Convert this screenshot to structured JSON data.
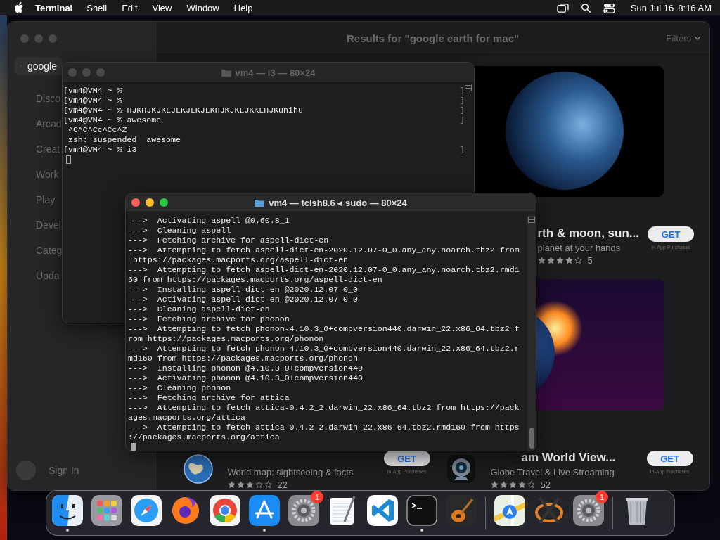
{
  "menu_bar": {
    "app_name": "Terminal",
    "menus": [
      "Shell",
      "Edit",
      "View",
      "Window",
      "Help"
    ],
    "date": "Sun Jul 16",
    "time": "8:16 AM"
  },
  "app_store": {
    "active": false,
    "search": {
      "value": "google"
    },
    "sidebar_items": [
      "Disco",
      "Arcad",
      "Creat",
      "Work",
      "Play",
      "Devel",
      "Categ",
      "Upda"
    ],
    "sign_in": "Sign In",
    "results_title": "Results for \"google earth for mac\"",
    "filters": "Filters",
    "featured": {
      "title": "rth & moon, sun...",
      "subtitle": "planet at your hands",
      "stars": 4,
      "rating_count": "5",
      "button": "GET",
      "note": "In-App Purchases"
    },
    "results": [
      {
        "kind": "globe",
        "subtitle": "World map: sightseeing & facts",
        "stars": 3,
        "rating_count": "22",
        "button": "GET",
        "note": "In-App Purchases"
      },
      {
        "kind": "webcam",
        "title": "am World View...",
        "subtitle": "Globe Travel & Live Streaming",
        "stars": 4,
        "rating_count": "52",
        "button": "GET",
        "note": "In-App Purchases"
      }
    ]
  },
  "back_terminal": {
    "title": "vm4 — i3 — 80×24",
    "active": false,
    "lines": [
      {
        "text": "[vm4@VM4 ~ %",
        "mark": "]"
      },
      {
        "text": "[vm4@VM4 ~ %",
        "mark": "]"
      },
      {
        "text": "[vm4@VM4 ~ % HJKHJKJKLJLKJLKJLKHJKJKLJKKLHJKunihu",
        "mark": "]"
      },
      {
        "text": "[vm4@VM4 ~ % awesome",
        "mark": "]"
      },
      {
        "text": " ^C^C^Cc^Cc^Z"
      },
      {
        "text": " zsh: suspended  awesome"
      },
      {
        "text": "[vm4@VM4 ~ % i3",
        "mark": "]"
      }
    ]
  },
  "front_terminal": {
    "title": "vm4 — tclsh8.6 ◂ sudo — 80×24",
    "active": true,
    "lines": [
      "--->  Activating aspell @0.60.8_1",
      "--->  Cleaning aspell",
      "--->  Fetching archive for aspell-dict-en",
      "--->  Attempting to fetch aspell-dict-en-2020.12.07-0_0.any_any.noarch.tbz2 from",
      " https://packages.macports.org/aspell-dict-en",
      "--->  Attempting to fetch aspell-dict-en-2020.12.07-0_0.any_any.noarch.tbz2.rmd1",
      "60 from https://packages.macports.org/aspell-dict-en",
      "--->  Installing aspell-dict-en @2020.12.07-0_0",
      "--->  Activating aspell-dict-en @2020.12.07-0_0",
      "--->  Cleaning aspell-dict-en",
      "--->  Fetching archive for phonon",
      "--->  Attempting to fetch phonon-4.10.3_0+compversion440.darwin_22.x86_64.tbz2 f",
      "rom https://packages.macports.org/phonon",
      "--->  Attempting to fetch phonon-4.10.3_0+compversion440.darwin_22.x86_64.tbz2.r",
      "md160 from https://packages.macports.org/phonon",
      "--->  Installing phonon @4.10.3_0+compversion440",
      "--->  Activating phonon @4.10.3_0+compversion440",
      "--->  Cleaning phonon",
      "--->  Fetching archive for attica",
      "--->  Attempting to fetch attica-0.4.2_2.darwin_22.x86_64.tbz2 from https://pack",
      "ages.macports.org/attica",
      "--->  Attempting to fetch attica-0.4.2_2.darwin_22.x86_64.tbz2.rmd160 from https",
      "://packages.macports.org/attica"
    ]
  },
  "dock": [
    {
      "kind": "finder",
      "running": true
    },
    {
      "kind": "launchpad",
      "running": false
    },
    {
      "kind": "safari",
      "running": false
    },
    {
      "kind": "firefox",
      "running": false
    },
    {
      "kind": "chrome",
      "running": false
    },
    {
      "kind": "appstore",
      "running": true
    },
    {
      "kind": "settings",
      "running": false,
      "badge": "1"
    },
    {
      "kind": "textedit",
      "running": false
    },
    {
      "kind": "vscode",
      "running": false
    },
    {
      "kind": "terminal",
      "running": true
    },
    {
      "kind": "guitar",
      "running": false
    },
    {
      "kind": "divider"
    },
    {
      "kind": "maps",
      "running": false
    },
    {
      "kind": "xquartz",
      "running": false
    },
    {
      "kind": "settings",
      "running": false,
      "badge": "1"
    },
    {
      "kind": "divider"
    },
    {
      "kind": "trash",
      "running": false
    }
  ]
}
